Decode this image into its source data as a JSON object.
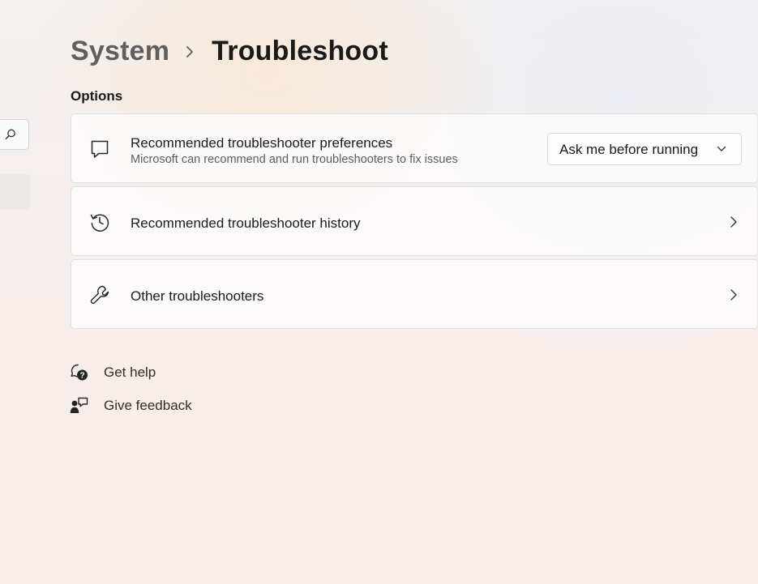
{
  "breadcrumb": {
    "parent": "System",
    "current": "Troubleshoot"
  },
  "section": {
    "title": "Options"
  },
  "options": [
    {
      "icon": "chat-bubble-icon",
      "title": "Recommended troubleshooter preferences",
      "description": "Microsoft can recommend and run troubleshooters to fix issues",
      "dropdown_value": "Ask me before running"
    },
    {
      "icon": "history-icon",
      "title": "Recommended troubleshooter history"
    },
    {
      "icon": "wrench-icon",
      "title": "Other troubleshooters"
    }
  ],
  "footer": {
    "get_help": "Get help",
    "give_feedback": "Give feedback"
  },
  "colors": {
    "accent_text": "#3b2a1f",
    "card_border": "#e3dfdf"
  }
}
